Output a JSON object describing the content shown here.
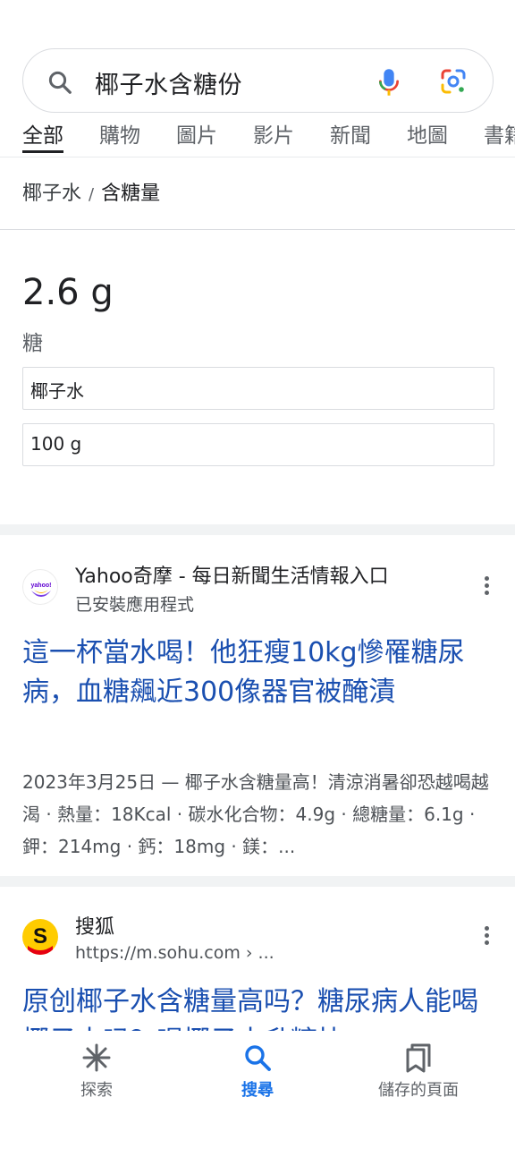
{
  "search": {
    "query": "椰子水含糖份"
  },
  "tabs": [
    {
      "label": "全部",
      "active": true
    },
    {
      "label": "購物"
    },
    {
      "label": "圖片"
    },
    {
      "label": "影片"
    },
    {
      "label": "新聞"
    },
    {
      "label": "地圖"
    },
    {
      "label": "書籍"
    }
  ],
  "breadcrumb": {
    "item1": "椰子水",
    "separator": "/",
    "item2": "含糖量"
  },
  "nutrition": {
    "value": "2.6 g",
    "label": "糖",
    "food_select": "椰子水",
    "amount_select": "100 g"
  },
  "results": [
    {
      "site_name": "Yahoo奇摩 - 每日新聞生活情報入口",
      "site_sub": "已安裝應用程式",
      "favicon_text": "yahoo!",
      "title": "這一杯當水喝！他狂瘦10kg慘罹糖尿病，血糖飆近300像器官被醃漬",
      "snippet": "2023年3月25日 — 椰子水含糖量高！清涼消暑卻恐越喝越渴 · 熱量：18Kcal · 碳水化合物：4.9g · 總糖量：6.1g · 鉀：214mg · 鈣：18mg · 鎂：..."
    },
    {
      "site_name": "搜狐",
      "site_sub": "https://m.sohu.com › ...",
      "favicon_text": "S",
      "title": "原创椰子水含糖量高吗？糖尿病人能喝椰子水吗？喝椰子水升糖快"
    }
  ],
  "bottom_nav": {
    "explore": "探索",
    "search": "搜尋",
    "saved": "儲存的頁面"
  },
  "colors": {
    "link": "#1a4fb0",
    "accent": "#1a73e8"
  }
}
